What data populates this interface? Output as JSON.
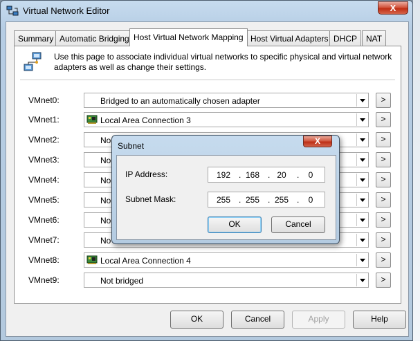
{
  "window": {
    "title": "Virtual Network Editor",
    "close_glyph": "X"
  },
  "tabs": [
    {
      "label": "Summary",
      "active": false
    },
    {
      "label": "Automatic Bridging",
      "active": false
    },
    {
      "label": "Host Virtual Network Mapping",
      "active": true
    },
    {
      "label": "Host Virtual Adapters",
      "active": false
    },
    {
      "label": "DHCP",
      "active": false
    },
    {
      "label": "NAT",
      "active": false
    }
  ],
  "description": "Use this page to associate individual virtual networks to specific physical and virtual network adapters as well as change their settings.",
  "networks": [
    {
      "label": "VMnet0:",
      "value": "Bridged to an automatically chosen adapter",
      "icon": ""
    },
    {
      "label": "VMnet1:",
      "value": "Local Area Connection 3",
      "icon": "network-adapter-icon"
    },
    {
      "label": "VMnet2:",
      "value": "No",
      "icon": ""
    },
    {
      "label": "VMnet3:",
      "value": "No",
      "icon": ""
    },
    {
      "label": "VMnet4:",
      "value": "No",
      "icon": ""
    },
    {
      "label": "VMnet5:",
      "value": "No",
      "icon": ""
    },
    {
      "label": "VMnet6:",
      "value": "No",
      "icon": ""
    },
    {
      "label": "VMnet7:",
      "value": "No",
      "icon": ""
    },
    {
      "label": "VMnet8:",
      "value": "Local Area Connection 4",
      "icon": "network-adapter-icon"
    },
    {
      "label": "VMnet9:",
      "value": "Not bridged",
      "icon": ""
    }
  ],
  "more_button_label": ">",
  "buttons": {
    "ok": "OK",
    "cancel": "Cancel",
    "apply": "Apply",
    "help": "Help"
  },
  "subnet_dialog": {
    "title": "Subnet",
    "close_glyph": "X",
    "ip_label": "IP Address:",
    "ip": [
      "192",
      "168",
      "20",
      "0"
    ],
    "mask_label": "Subnet Mask:",
    "mask": [
      "255",
      "255",
      "255",
      "0"
    ],
    "dot": ".",
    "ok": "OK",
    "cancel": "Cancel"
  }
}
